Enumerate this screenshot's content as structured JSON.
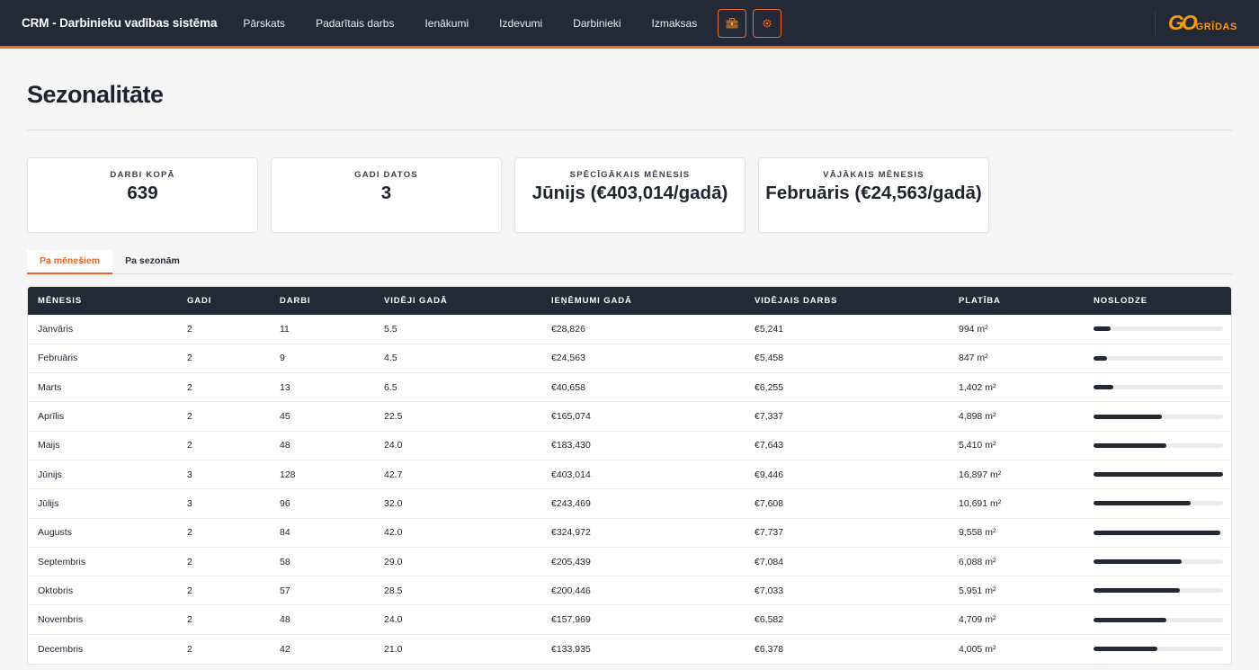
{
  "app": {
    "title": "CRM - Darbinieku vadības sistēma",
    "nav": [
      "Pārskats",
      "Padarītais darbs",
      "Ienākumi",
      "Izdevumi",
      "Darbinieki",
      "Izmaksas"
    ],
    "icons": [
      "briefcase-icon",
      "gear-icon"
    ],
    "logo": {
      "mark": "GO",
      "text": "GRĪDAS"
    },
    "accent": "#f06a2a",
    "dark": "#232a35"
  },
  "page": {
    "title": "Sezonalitāte"
  },
  "cards": [
    {
      "label": "Darbi kopā",
      "value": "639"
    },
    {
      "label": "Gadi datos",
      "value": "3"
    },
    {
      "label": "Spēcīgākais mēnesis",
      "value": "Jūnijs (€403,014/gadā)"
    },
    {
      "label": "Vājākais mēnesis",
      "value": "Februāris (€24,563/gadā)"
    }
  ],
  "tabs": [
    {
      "label": "Pa mēnešiem",
      "active": true
    },
    {
      "label": "Pa sezonām",
      "active": false
    }
  ],
  "table": {
    "headers": [
      "Mēnesis",
      "Gadi",
      "Darbi",
      "Vidēji gadā",
      "Ieņēmumi gadā",
      "Vidējais darbs",
      "Platība",
      "Noslodze"
    ],
    "rows": [
      {
        "month": "Janvāris",
        "years": "2",
        "jobs": "11",
        "avg": "5.5",
        "revenue": "€28,826",
        "avg_job": "€5,241",
        "area": "994 m²",
        "load": 0.13
      },
      {
        "month": "Februāris",
        "years": "2",
        "jobs": "9",
        "avg": "4.5",
        "revenue": "€24,563",
        "avg_job": "€5,458",
        "area": "847 m²",
        "load": 0.105
      },
      {
        "month": "Marts",
        "years": "2",
        "jobs": "13",
        "avg": "6.5",
        "revenue": "€40,658",
        "avg_job": "€6,255",
        "area": "1,402 m²",
        "load": 0.15
      },
      {
        "month": "Aprīlis",
        "years": "2",
        "jobs": "45",
        "avg": "22.5",
        "revenue": "€165,074",
        "avg_job": "€7,337",
        "area": "4,898 m²",
        "load": 0.53
      },
      {
        "month": "Maijs",
        "years": "2",
        "jobs": "48",
        "avg": "24.0",
        "revenue": "€183,430",
        "avg_job": "€7,643",
        "area": "5,410 m²",
        "load": 0.56
      },
      {
        "month": "Jūnijs",
        "years": "3",
        "jobs": "128",
        "avg": "42.7",
        "revenue": "€403,014",
        "avg_job": "€9,446",
        "area": "16,897 m²",
        "load": 1.0
      },
      {
        "month": "Jūlijs",
        "years": "3",
        "jobs": "96",
        "avg": "32.0",
        "revenue": "€243,469",
        "avg_job": "€7,608",
        "area": "10,691 m²",
        "load": 0.75
      },
      {
        "month": "Augusts",
        "years": "2",
        "jobs": "84",
        "avg": "42.0",
        "revenue": "€324,972",
        "avg_job": "€7,737",
        "area": "9,558 m²",
        "load": 0.98
      },
      {
        "month": "Septembris",
        "years": "2",
        "jobs": "58",
        "avg": "29.0",
        "revenue": "€205,439",
        "avg_job": "€7,084",
        "area": "6,088 m²",
        "load": 0.68
      },
      {
        "month": "Oktobris",
        "years": "2",
        "jobs": "57",
        "avg": "28.5",
        "revenue": "€200,446",
        "avg_job": "€7,033",
        "area": "5,951 m²",
        "load": 0.67
      },
      {
        "month": "Novembris",
        "years": "2",
        "jobs": "48",
        "avg": "24.0",
        "revenue": "€157,969",
        "avg_job": "€6,582",
        "area": "4,709 m²",
        "load": 0.56
      },
      {
        "month": "Decembris",
        "years": "2",
        "jobs": "42",
        "avg": "21.0",
        "revenue": "€133,935",
        "avg_job": "€6,378",
        "area": "4,005 m²",
        "load": 0.49
      }
    ]
  }
}
